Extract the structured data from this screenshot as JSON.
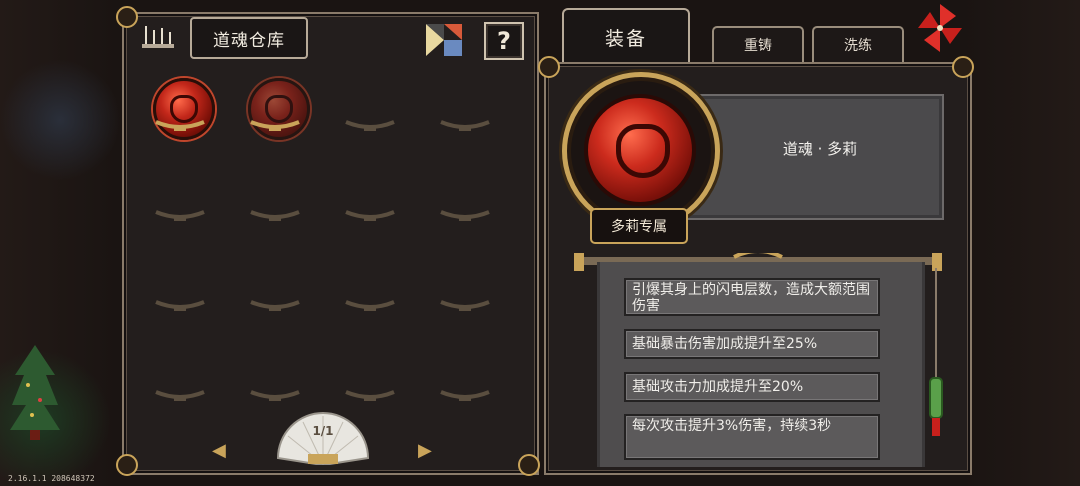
{
  "storage": {
    "title": "道魂仓库",
    "help_label": "?",
    "page_indicator": "1/1",
    "slots": [
      {
        "filled": true,
        "dim": false
      },
      {
        "filled": true,
        "dim": true
      },
      {
        "filled": false
      },
      {
        "filled": false
      },
      {
        "filled": false
      },
      {
        "filled": false
      },
      {
        "filled": false
      },
      {
        "filled": false
      },
      {
        "filled": false
      },
      {
        "filled": false
      },
      {
        "filled": false
      },
      {
        "filled": false
      },
      {
        "filled": false
      },
      {
        "filled": false
      },
      {
        "filled": false
      },
      {
        "filled": false
      }
    ]
  },
  "tabs": {
    "equip": "装备",
    "recast": "重铸",
    "refine": "洗练"
  },
  "item": {
    "name": "道魂 · 多莉",
    "exclusive_badge": "多莉专属",
    "effects": [
      "引爆其身上的闪电层数，造成大额范围伤害",
      "基础暴击伤害加成提升至25%",
      "基础攻击力加成提升至20%",
      "每次攻击提升3%伤害，持续3秒"
    ]
  },
  "version": "2.16.1.1 208648372",
  "colors": {
    "gold": "#c9a45a",
    "orb_red": "#cc2b1d",
    "panel": "#231e1d"
  }
}
